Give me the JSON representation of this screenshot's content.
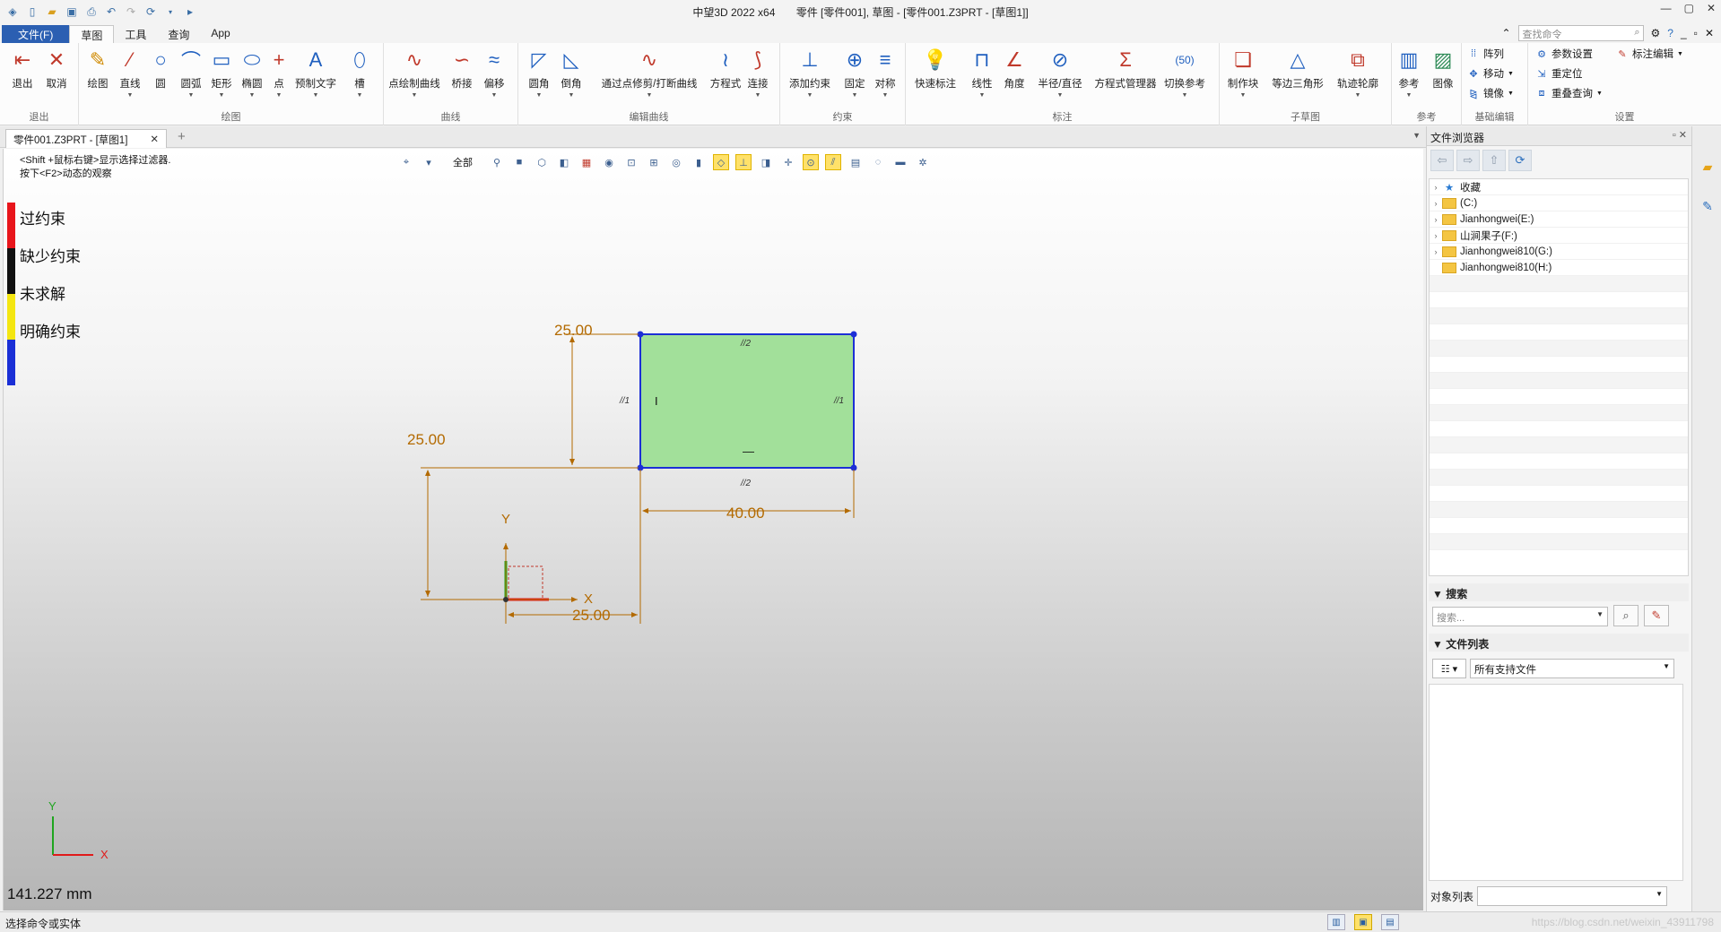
{
  "titlebar": {
    "app": "中望3D 2022 x64",
    "doc": "零件 [零件001], 草图 - [零件001.Z3PRT - [草图1]]"
  },
  "menubar": {
    "file": "文件(F)",
    "tabs": [
      "草图",
      "工具",
      "查询",
      "App"
    ],
    "search_placeholder": "查找命令"
  },
  "ribbon": {
    "groups": [
      "退出",
      "绘图",
      "曲线",
      "编辑曲线",
      "约束",
      "标注",
      "子草图",
      "参考",
      "基础编辑",
      "设置"
    ],
    "exit_buttons": [
      "退出",
      "取消"
    ],
    "draw_buttons": [
      "绘图",
      "直线",
      "圆",
      "圆弧",
      "矩形",
      "椭圆",
      "点",
      "预制文字",
      "槽"
    ],
    "curve_buttons": [
      "点绘制曲线",
      "桥接",
      "偏移"
    ],
    "edit_buttons": [
      "圆角",
      "倒角",
      "通过点修剪/打断曲线",
      "方程式",
      "连接"
    ],
    "constraint_buttons": [
      "添加约束",
      "固定",
      "对称"
    ],
    "dim_buttons": [
      "快速标注",
      "线性",
      "角度",
      "半径/直径",
      "方程式管理器",
      "切换参考"
    ],
    "sub_buttons": [
      "制作块",
      "等边三角形",
      "轨迹轮廓"
    ],
    "ref_buttons": [
      "参考",
      "图像"
    ],
    "basic_edit": [
      "阵列",
      "移动",
      "镜像"
    ],
    "settings": [
      "参数设置",
      "重定位",
      "重叠查询"
    ],
    "annot_edit": "标注编辑"
  },
  "doc_tab": {
    "label": "零件001.Z3PRT - [草图1]"
  },
  "canvas": {
    "hint_line1": "<Shift +鼠标右键>显示选择过滤器.",
    "hint_line2": "按下<F2>动态的观察",
    "filter_label": "全部",
    "legend": [
      {
        "label": "过约束",
        "color": "#e8151b"
      },
      {
        "label": "缺少约束",
        "color": "#111111"
      },
      {
        "label": "未求解",
        "color": "#f4e611"
      },
      {
        "label": "明确约束",
        "color": "#1a2fd6"
      }
    ],
    "dims": {
      "height_rect": "25.00",
      "height_offset": "25.00",
      "width_rect": "40.00",
      "width_offset": "25.00"
    },
    "constraint_marks": {
      "top": "//2",
      "bottom": "//2",
      "left": "//1",
      "right": "//1",
      "vert": "I",
      "horiz": "—"
    },
    "axis_x": "X",
    "axis_y": "Y",
    "coord_readout": "141.227 mm"
  },
  "right_panel": {
    "title": "文件浏览器",
    "tree": [
      {
        "label": "收藏",
        "type": "star"
      },
      {
        "label": "(C:)",
        "type": "folder"
      },
      {
        "label": "Jianhongwei(E:)",
        "type": "folder"
      },
      {
        "label": "山涧果子(F:)",
        "type": "folder"
      },
      {
        "label": "Jianhongwei810(G:)",
        "type": "folder"
      },
      {
        "label": "Jianhongwei810(H:)",
        "type": "folder"
      }
    ],
    "search_section": "搜索",
    "search_placeholder": "搜索...",
    "filelist_section": "文件列表",
    "filetype": "所有支持文件",
    "objlist_label": "对象列表"
  },
  "status": {
    "text": "选择命令或实体",
    "watermark": "https://blog.csdn.net/weixin_43911798"
  }
}
